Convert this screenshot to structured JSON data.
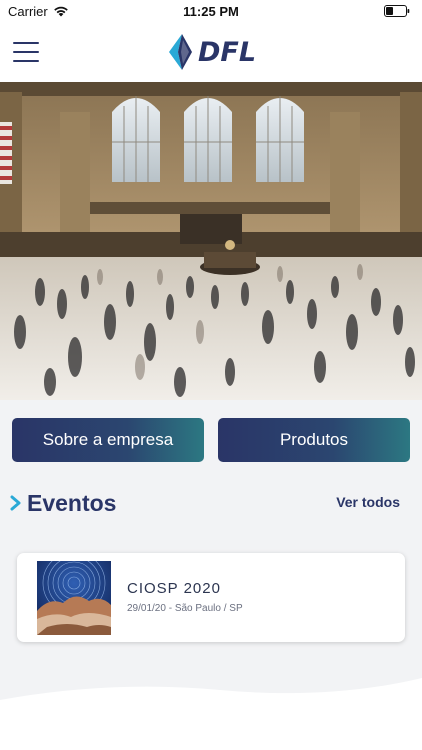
{
  "status_bar": {
    "carrier": "Carrier",
    "time": "11:25 PM"
  },
  "header": {
    "logo_text": "DFL"
  },
  "buttons": {
    "about": "Sobre a empresa",
    "products": "Produtos"
  },
  "events_section": {
    "title": "Eventos",
    "see_all": "Ver todos"
  },
  "events": [
    {
      "title": "CIOSP 2020",
      "meta": "29/01/20 - São Paulo / SP"
    }
  ],
  "colors": {
    "brand_navy": "#2a3567",
    "brand_teal": "#2c7882",
    "accent_cyan": "#2aa9d6",
    "background": "#f2f3f5"
  },
  "icons": {
    "menu": "hamburger-icon",
    "section": "chevron-right-icon",
    "wifi": "wifi-icon",
    "battery": "battery-icon"
  }
}
